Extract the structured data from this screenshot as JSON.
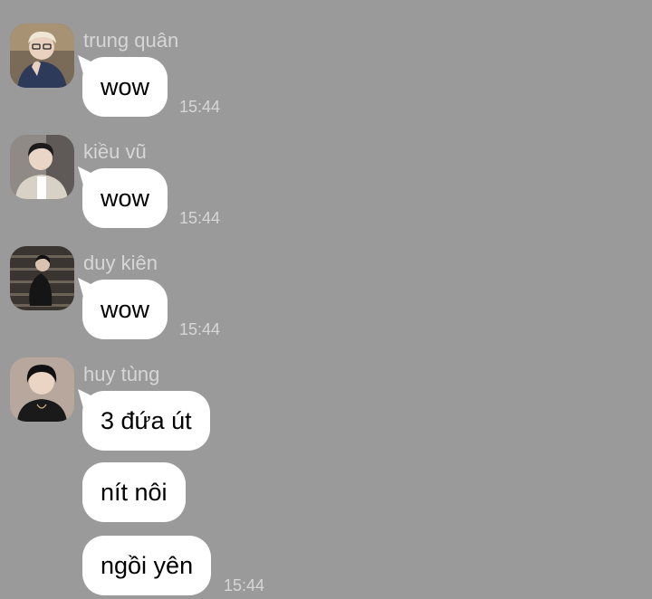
{
  "messages": [
    {
      "sender": "trung quân",
      "avatar_icon": "user-avatar-icon",
      "bubbles": [
        "wow"
      ],
      "time": "15:44"
    },
    {
      "sender": "kiều vũ",
      "avatar_icon": "user-avatar-icon",
      "bubbles": [
        "wow"
      ],
      "time": "15:44"
    },
    {
      "sender": "duy kiên",
      "avatar_icon": "user-avatar-icon",
      "bubbles": [
        "wow"
      ],
      "time": "15:44"
    },
    {
      "sender": "huy tùng",
      "avatar_icon": "user-avatar-icon",
      "bubbles": [
        "3 đứa út",
        "nít nôi",
        "ngồi yên"
      ],
      "time": "15:44"
    }
  ],
  "colors": {
    "background": "#9a9a9a",
    "bubble": "#ffffff",
    "meta_text": "#d6d6d6"
  }
}
